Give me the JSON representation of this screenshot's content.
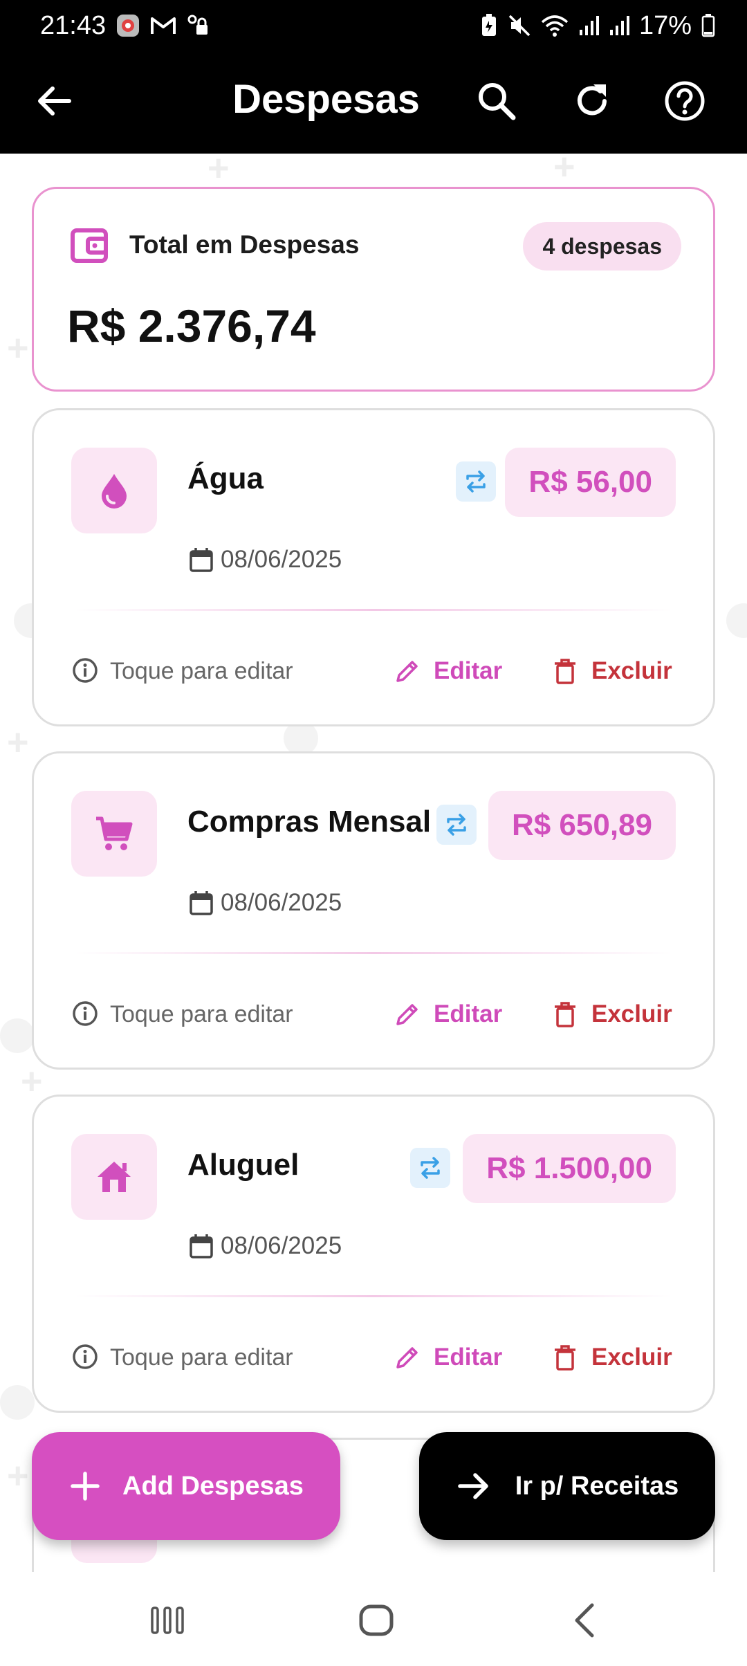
{
  "status_bar": {
    "time": "21:43",
    "battery": "17%"
  },
  "app_bar": {
    "title": "Despesas"
  },
  "summary": {
    "label": "Total em Despesas",
    "count_badge": "4 despesas",
    "total": "R$ 2.376,74"
  },
  "expenses": [
    {
      "name": "Água",
      "amount": "R$ 56,00",
      "date": "08/06/2025",
      "category_icon": "water-drop-icon",
      "recurring": true
    },
    {
      "name": "Compras Mensal",
      "amount": "R$ 650,89",
      "date": "08/06/2025",
      "category_icon": "shopping-cart-icon",
      "recurring": true
    },
    {
      "name": "Aluguel",
      "amount": "R$ 1.500,00",
      "date": "08/06/2025",
      "category_icon": "house-icon",
      "recurring": true
    }
  ],
  "card_actions": {
    "hint": "Toque para editar",
    "edit_label": "Editar",
    "delete_label": "Excluir"
  },
  "fabs": {
    "add_label": "Add Despesas",
    "receitas_label": "Ir p/ Receitas"
  },
  "colors": {
    "accent": "#d64fc1",
    "accent_light": "#fbe6f4",
    "delete": "#c4333b",
    "recurring": "#3aa0e6"
  }
}
